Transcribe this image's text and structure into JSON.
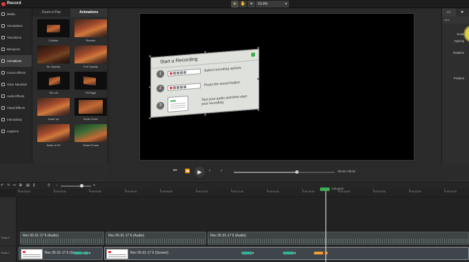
{
  "app": {
    "title": "Record"
  },
  "toolbar": {
    "zoom_value": "53.8%",
    "tools": [
      "pointer-icon",
      "hand-icon",
      "crop-icon"
    ]
  },
  "nav": {
    "items": [
      {
        "label": "Media",
        "icon": "media-icon"
      },
      {
        "label": "Annotations",
        "icon": "annotation-icon"
      },
      {
        "label": "Transitions",
        "icon": "transition-icon"
      },
      {
        "label": "Behaviors",
        "icon": "behavior-icon"
      },
      {
        "label": "Animations",
        "icon": "animation-icon",
        "active": true
      },
      {
        "label": "Cursor Effects",
        "icon": "cursor-icon"
      },
      {
        "label": "Voice Narration",
        "icon": "mic-icon"
      },
      {
        "label": "Audio Effects",
        "icon": "audio-icon"
      },
      {
        "label": "Visual Effects",
        "icon": "visual-icon"
      },
      {
        "label": "Interactivity",
        "icon": "interactivity-icon"
      },
      {
        "label": "Captions",
        "icon": "cc-icon"
      }
    ]
  },
  "animations": {
    "tabs": [
      {
        "label": "Zoom-n-Pan"
      },
      {
        "label": "Animations",
        "active": true
      }
    ],
    "tiles": [
      {
        "label": "Custom"
      },
      {
        "label": "Restore"
      },
      {
        "label": "No Opacity"
      },
      {
        "label": "Full Opacity"
      },
      {
        "label": "Tilt Left"
      },
      {
        "label": "Tilt Right"
      },
      {
        "label": "Scale Up"
      },
      {
        "label": "Scale Down"
      },
      {
        "label": "Scale to Fit"
      },
      {
        "label": "Smart Focus"
      }
    ]
  },
  "recording_card": {
    "title": "Start a Recording",
    "steps": [
      {
        "num": "1",
        "text": "Select recording options"
      },
      {
        "num": "2",
        "text": "Press the record button"
      },
      {
        "num": "3",
        "text": "Test your audio and then start your recording"
      }
    ]
  },
  "properties": {
    "subtabs": "◂ ▸ ▸",
    "labels": [
      "Scale",
      "Opacity",
      "Rotation",
      "Position"
    ]
  },
  "playback": {
    "time": "00:16 / 00:42"
  },
  "timeline": {
    "ticks": [
      "0:00:00;00",
      "0:00:02;00",
      "0:00:04;00",
      "0:00:06;00",
      "0:00:08;00",
      "0:00:10;00",
      "0:00:12;00",
      "0:00:14;00",
      "0:00:16;00",
      "0:00:18;00",
      "0:00:20;00",
      "0:00:22;00",
      "0:00:24;00"
    ],
    "playhead_time": "0:00:16;00",
    "tracks": [
      {
        "name": "Track 2",
        "clips": [
          {
            "title": "Rec 05-31-17 6 (Audio)"
          },
          {
            "title": "Rec 05-31-17 6 (Audio)"
          },
          {
            "title": "Rec 05-31-17 6 (Audio)"
          }
        ]
      },
      {
        "name": "Track 1",
        "clips": [
          {
            "title": "Rec 05-31-17 6 (Scr"
          },
          {
            "title": "Rec 05-31-17 6 (Screen)"
          }
        ]
      }
    ]
  },
  "colors": {
    "accent_green": "#3fae55",
    "record_red": "#e8343a",
    "highlight_yellow": "#f1e35f",
    "marker_teal": "#33b39a",
    "marker_orange": "#f0a12b"
  }
}
